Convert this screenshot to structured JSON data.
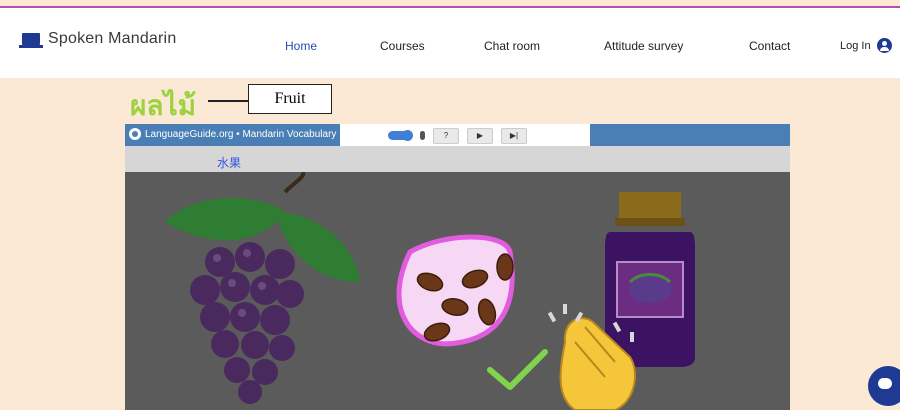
{
  "site": {
    "name": "Spoken Mandarin"
  },
  "nav": {
    "items": [
      {
        "label": "Home",
        "active": true
      },
      {
        "label": "Courses",
        "active": false
      },
      {
        "label": "Chat room",
        "active": false
      },
      {
        "label": "Attitude survey",
        "active": false
      },
      {
        "label": "Contact",
        "active": false
      }
    ],
    "login_label": "Log In"
  },
  "lesson": {
    "thai_word": "ผลไม้",
    "english_word": "Fruit"
  },
  "video": {
    "title": "LanguageGuide.org • Mandarin Vocabulary",
    "chinese_word": "水果",
    "controls": {
      "help": "?",
      "play": "▶",
      "next": "▶|"
    }
  },
  "colors": {
    "accent": "#2b49b8",
    "brand": "#1f3a93",
    "thai_green": "#9dd23f",
    "top_line": "#b44fb0"
  }
}
